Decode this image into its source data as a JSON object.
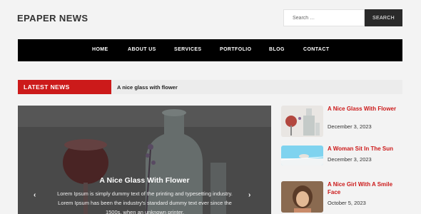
{
  "header": {
    "site_title": "EPAPER NEWS",
    "search": {
      "placeholder": "Search …",
      "button_label": "SEARCH"
    }
  },
  "nav": {
    "items": [
      {
        "label": "HOME"
      },
      {
        "label": "ABOUT US"
      },
      {
        "label": "SERVICES"
      },
      {
        "label": "PORTFOLIO"
      },
      {
        "label": "BLOG"
      },
      {
        "label": "CONTACT"
      }
    ]
  },
  "ticker": {
    "label": "LATEST NEWS",
    "headline": "A nice glass with flower"
  },
  "slider": {
    "title": "A Nice Glass With Flower",
    "text": "Lorem Ipsum is simply dummy text of the printing and typesetting industry. Lorem Ipsum has been the industry's standard dummy text ever since the 1500s, when an unknown printer.",
    "prev_glyph": "‹",
    "next_glyph": "›"
  },
  "sidebar": {
    "posts": [
      {
        "title": "A Nice Glass With Flower",
        "date": "December 3, 2023",
        "thumb_icon": "glass-flower-image"
      },
      {
        "title": "A Woman Sit In The Sun",
        "date": "December 3, 2023",
        "thumb_icon": "pool-image"
      },
      {
        "title": "A Nice Girl With A Smile Face",
        "date": "October 5, 2023",
        "thumb_icon": "girl-portrait-image"
      }
    ]
  },
  "colors": {
    "accent": "#cc1a1a",
    "nav_bg": "#000000",
    "search_btn": "#2a2a2a"
  }
}
